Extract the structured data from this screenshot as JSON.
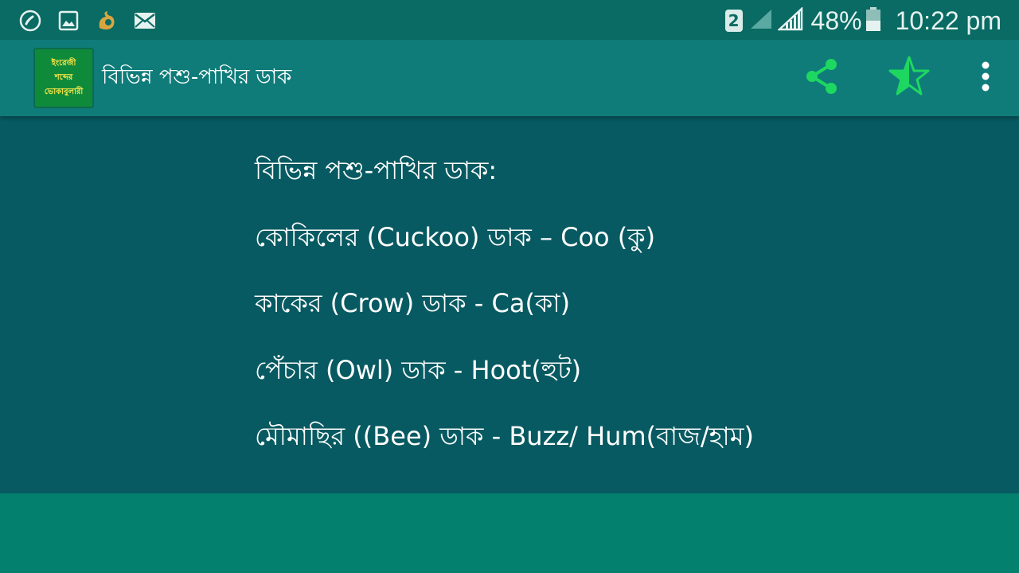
{
  "status_bar": {
    "left_icons": [
      "phone-call-icon",
      "gallery-icon",
      "uc-browser-icon",
      "mail-icon"
    ],
    "sim_slot": "2",
    "battery_percent": "48%",
    "time": "10:22 pm"
  },
  "app_bar": {
    "logo_lines": [
      "ইংরেজী",
      "শব্দের",
      "ভোকাবুলারী"
    ],
    "title": "বিভিন্ন পশু-পাখির ডাক",
    "actions": [
      "share-icon",
      "star-half-icon",
      "more-vert-icon"
    ],
    "colors": {
      "action_green": "#1ed760"
    }
  },
  "content": {
    "lines": [
      "বিভিন্ন পশু-পাখির ডাক:",
      "কোকিলের (Cuckoo) ডাক – Coo (কু)",
      "কাকের (Crow) ডাক - Ca(কা)",
      "পেঁচার (Owl) ডাক - Hoot(হুট)",
      "মৌমাছির ((Bee) ডাক - Buzz/ Hum(বাজ/হাম)"
    ]
  },
  "colors": {
    "status_bar": "#096b63",
    "app_bar": "#0f7c7a",
    "content_bg": "#075a61",
    "bottom_bg": "#04806f"
  }
}
